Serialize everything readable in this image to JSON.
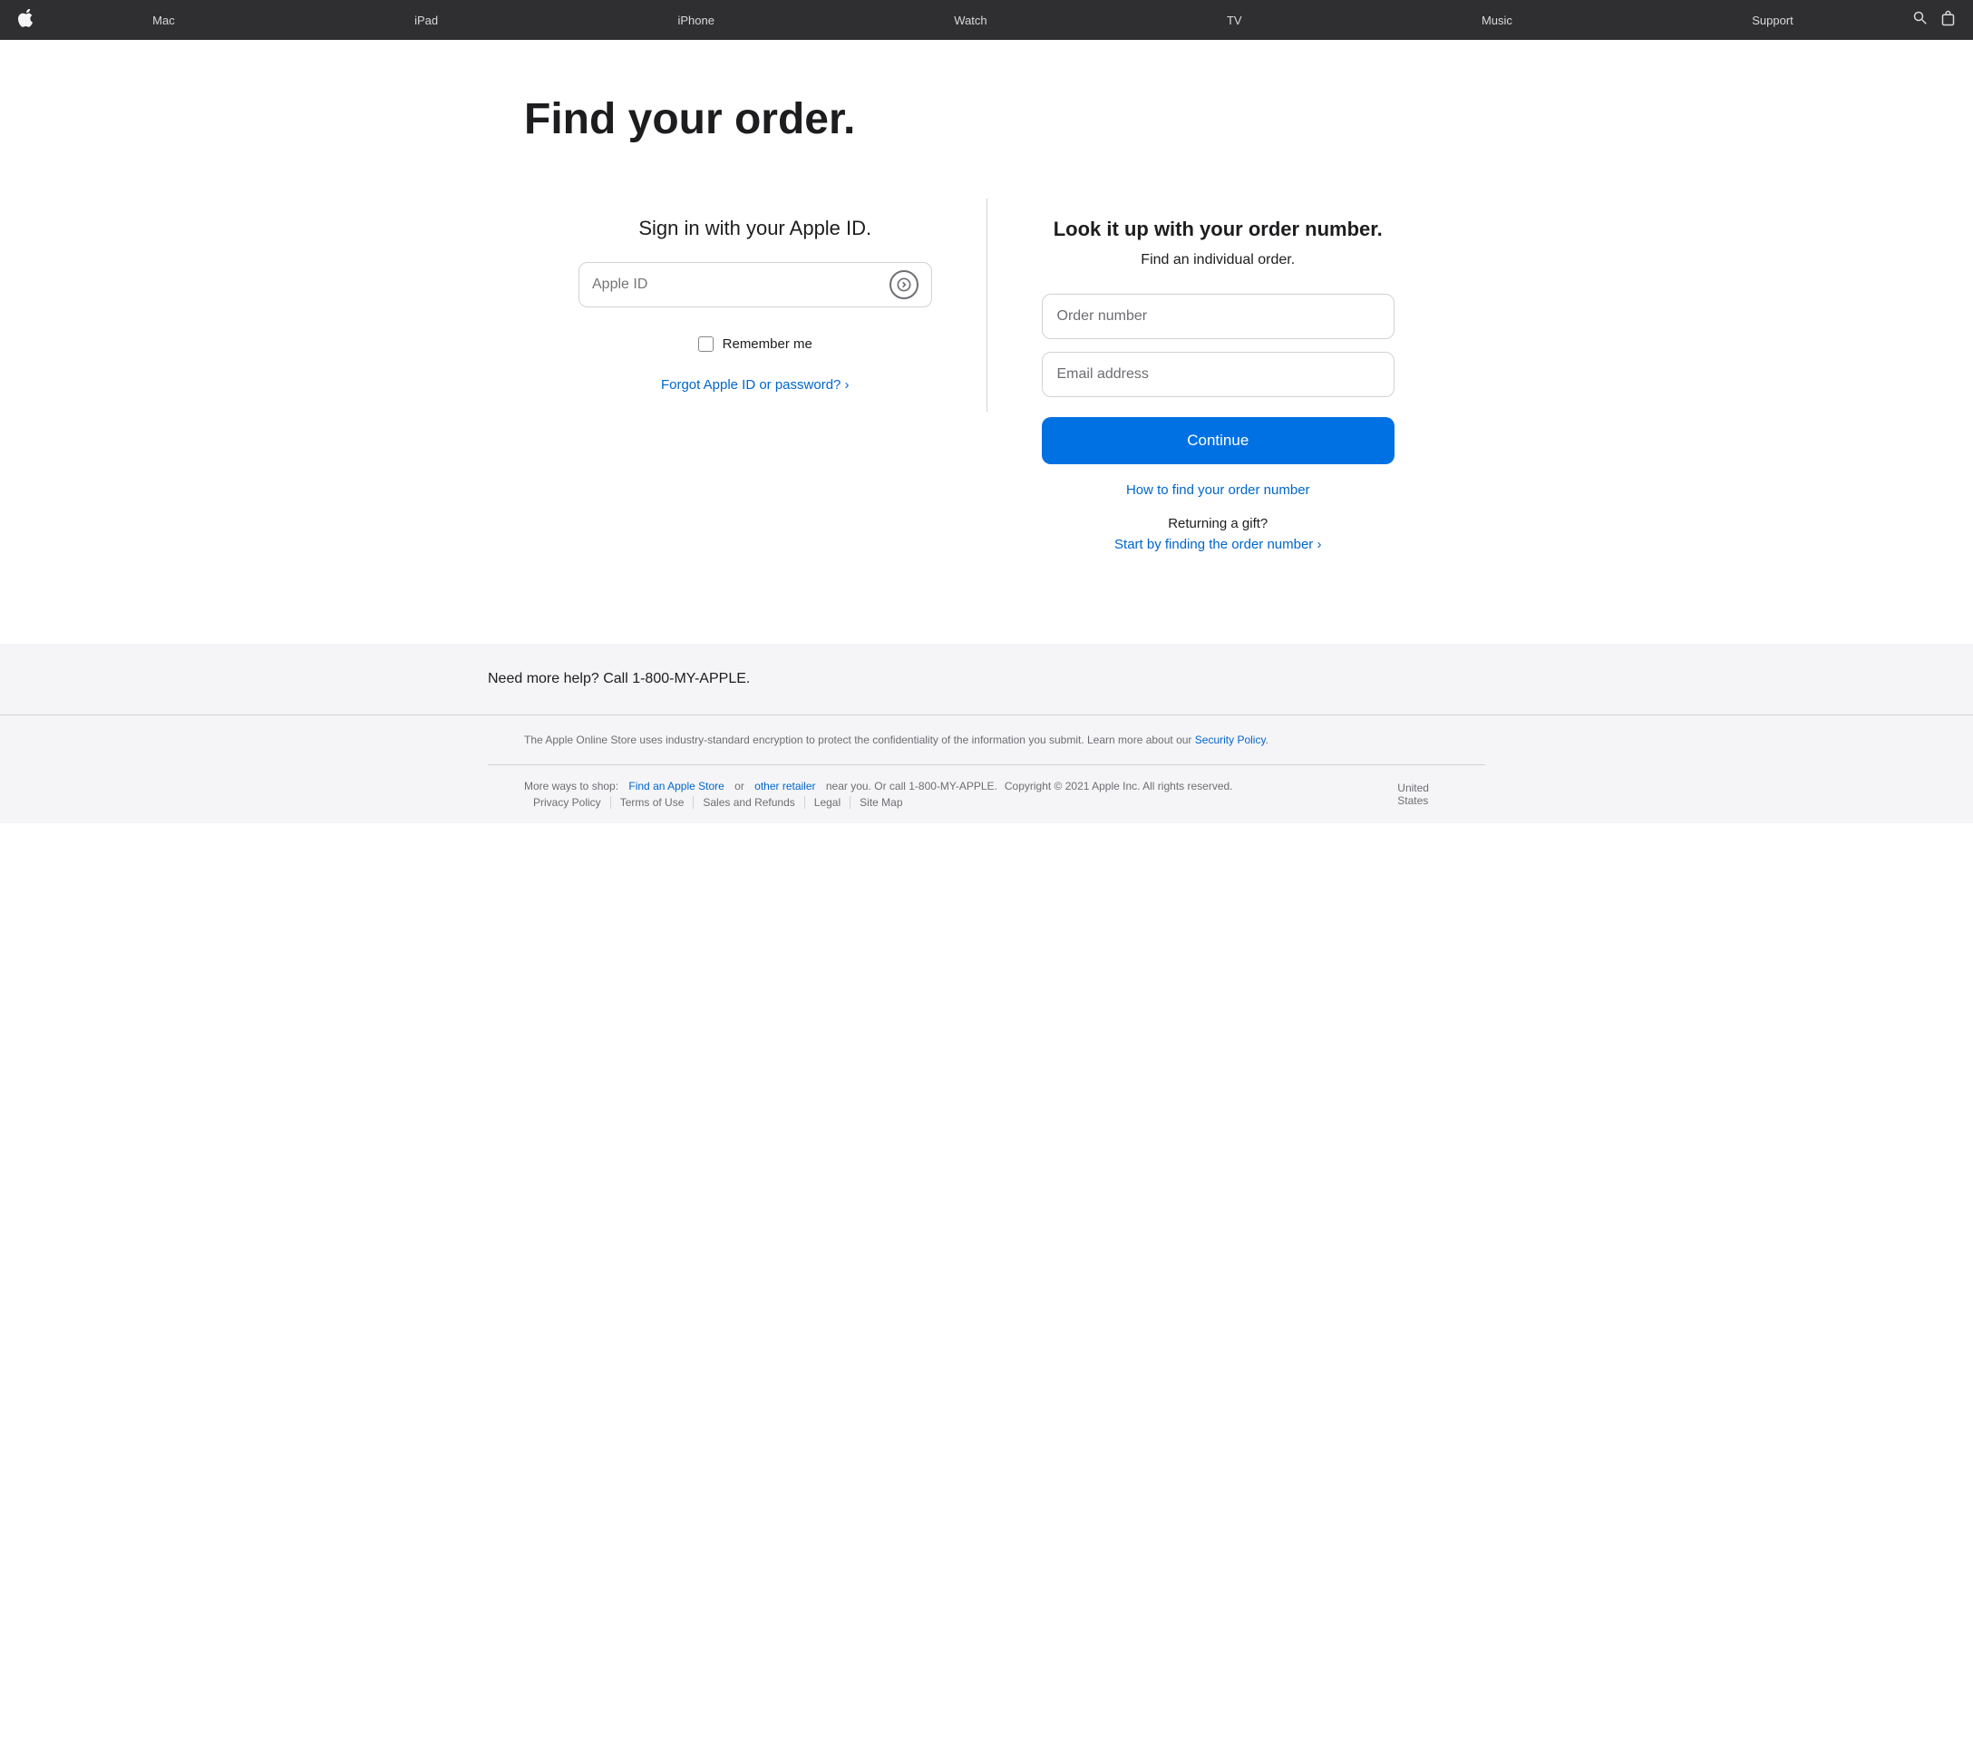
{
  "nav": {
    "logo": "🍎",
    "items": [
      {
        "label": "Mac",
        "key": "mac"
      },
      {
        "label": "iPad",
        "key": "ipad"
      },
      {
        "label": "iPhone",
        "key": "iphone"
      },
      {
        "label": "Watch",
        "key": "watch"
      },
      {
        "label": "TV",
        "key": "tv"
      },
      {
        "label": "Music",
        "key": "music"
      },
      {
        "label": "Support",
        "key": "support"
      }
    ]
  },
  "page": {
    "title": "Find your order.",
    "left": {
      "sign_in_title": "Sign in with your Apple ID.",
      "apple_id_placeholder": "Apple ID",
      "remember_label": "Remember me",
      "forgot_link": "Forgot Apple ID or password? ›"
    },
    "right": {
      "lookup_title": "Look it up with your order number.",
      "lookup_subtitle": "Find an individual order.",
      "order_placeholder": "Order number",
      "email_placeholder": "Email address",
      "continue_label": "Continue",
      "find_order_link": "How to find your order number",
      "returning_text": "Returning a gift?",
      "start_link": "Start by finding the order number ›"
    }
  },
  "help": {
    "text": "Need more help? Call 1-800-MY-APPLE."
  },
  "footer": {
    "security_text": "The Apple Online Store uses industry-standard encryption to protect the confidentiality of the information you submit. Learn more about our",
    "security_link": "Security Policy",
    "more_ways_text": "More ways to shop:",
    "find_store_link": "Find an Apple Store",
    "or_text": "or",
    "other_retailer_link": "other retailer",
    "near_you_text": "near you. Or call 1-800-MY-APPLE.",
    "copyright": "Copyright © 2021 Apple Inc. All rights reserved.",
    "links": [
      {
        "label": "Privacy Policy"
      },
      {
        "label": "Terms of Use"
      },
      {
        "label": "Sales and Refunds"
      },
      {
        "label": "Legal"
      },
      {
        "label": "Site Map"
      }
    ],
    "region": "United States"
  }
}
